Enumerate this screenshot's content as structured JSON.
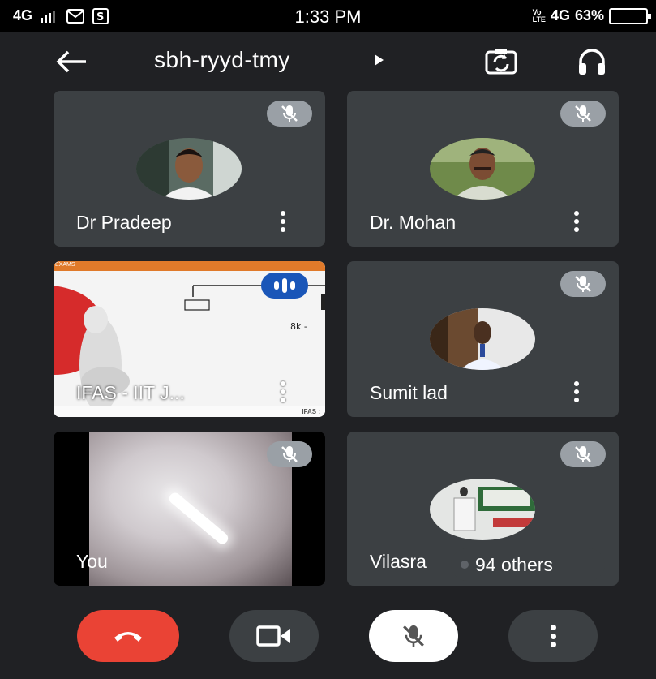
{
  "status_bar": {
    "network": "4G",
    "time": "1:33 PM",
    "volte_label": "VoLTE",
    "network_right": "4G",
    "battery": "63%"
  },
  "header": {
    "meeting_code": "sbh-ryyd-tmy"
  },
  "participants": [
    {
      "name": "Dr Pradeep",
      "muted": true,
      "icon": "mic-off-icon"
    },
    {
      "name": "Dr. Mohan",
      "muted": true,
      "icon": "mic-off-icon"
    },
    {
      "name": "IFAS - IIT J...",
      "presenting": true,
      "speaking": true,
      "band_text": "EXAMS",
      "footer_text": "IFAS : "
    },
    {
      "name": "Sumit lad",
      "muted": true,
      "icon": "mic-off-icon"
    },
    {
      "name": "You",
      "muted": true,
      "icon": "mic-off-icon"
    },
    {
      "name": "Vilasra",
      "muted": true,
      "icon": "mic-off-icon"
    }
  ],
  "others": {
    "label": "94 others"
  },
  "controls": {
    "end_call": "end-call-icon",
    "camera": "video-camera-icon",
    "mic": "mic-off-icon",
    "more": "more-vert-icon"
  },
  "colors": {
    "end_call": "#ea4335",
    "speaking": "#1a56b8",
    "tile_bg": "#3c4043",
    "app_bg": "#202124"
  }
}
